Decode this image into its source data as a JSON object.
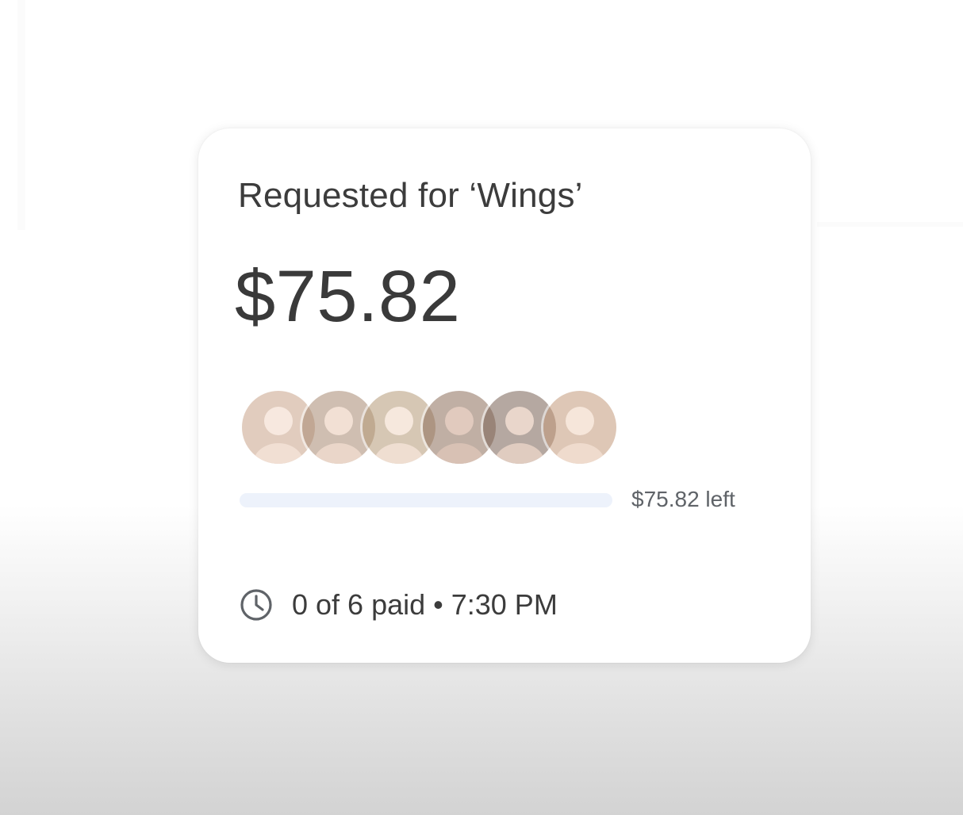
{
  "request": {
    "title": "Requested for ‘Wings’",
    "amount": "$75.82",
    "remaining_label": "$75.82 left",
    "paid_fraction": 0,
    "status": "0 of 6 paid • 7:30 PM"
  },
  "participants": [
    {
      "avatar_icon": "person-avatar",
      "color": "#c9a48a"
    },
    {
      "avatar_icon": "person-avatar",
      "color": "#a88a72"
    },
    {
      "avatar_icon": "person-avatar",
      "color": "#b59a78"
    },
    {
      "avatar_icon": "person-avatar",
      "color": "#8d6e5a"
    },
    {
      "avatar_icon": "person-avatar",
      "color": "#7a6255"
    },
    {
      "avatar_icon": "person-avatar",
      "color": "#c49a7c"
    }
  ],
  "colors": {
    "accent": "#4285f4",
    "track": "#edf2fb",
    "text_primary": "#3c3c3c",
    "text_secondary": "#5f6368"
  },
  "icons": {
    "status": "clock-icon"
  }
}
